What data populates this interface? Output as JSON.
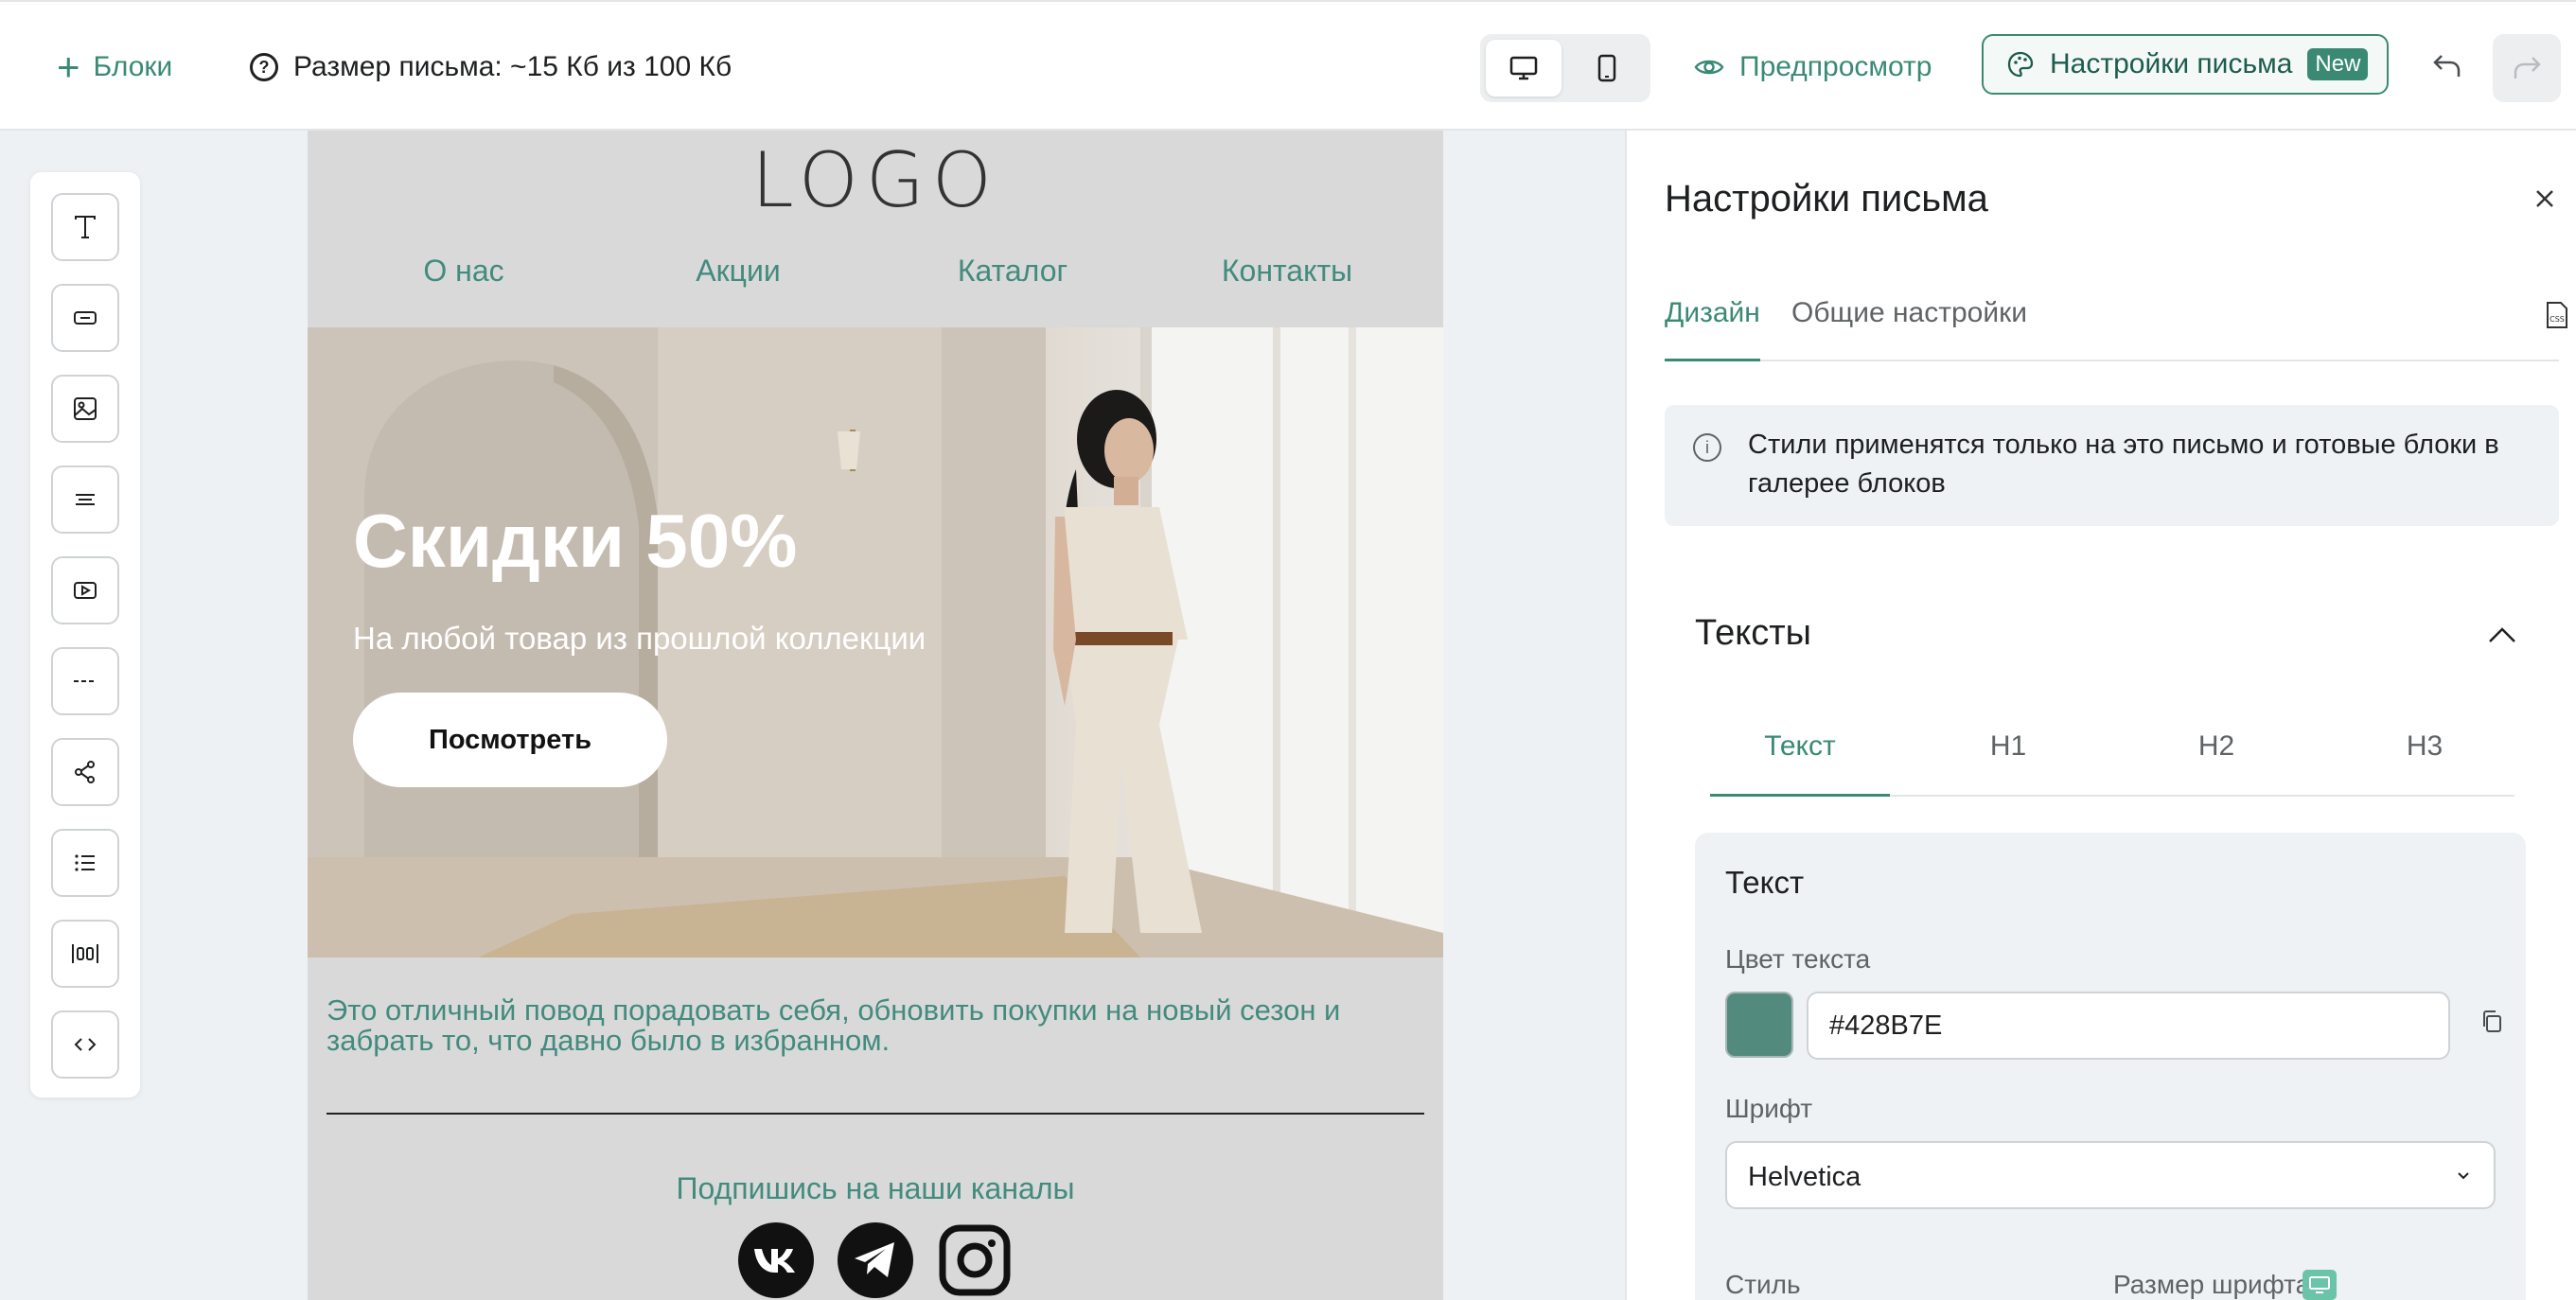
{
  "topbar": {
    "blocks_label": "Блоки",
    "size_label": "Размер письма: ~15 Кб из 100 Кб",
    "preview_label": "Предпросмотр",
    "settings_label": "Настройки письма",
    "new_badge": "New"
  },
  "email": {
    "logo": "LOGO",
    "nav": [
      "О нас",
      "Акции",
      "Каталог",
      "Контакты"
    ],
    "hero_title": "Скидки 50%",
    "hero_subtitle": "На любой товар из прошлой коллекции",
    "hero_button": "Посмотреть",
    "promo_text": "Это отличный повод порадовать себя, обновить покупки на новый сезон и забрать то, что давно было в избранном.",
    "subscribe_text": "Подпишись на наши каналы",
    "social_icons": [
      "vk-icon",
      "telegram-icon",
      "instagram-icon"
    ]
  },
  "panel": {
    "title": "Настройки письма",
    "tabs": [
      "Дизайн",
      "Общие настройки"
    ],
    "active_tab": "Дизайн",
    "info_text": "Стили применятся только на это письмо и готовые блоки в галерее блоков",
    "section_title": "Тексты",
    "sub_tabs": [
      "Текст",
      "H1",
      "H2",
      "H3"
    ],
    "active_sub_tab": "Текст",
    "card": {
      "title": "Текст",
      "color_label": "Цвет текста",
      "color_value": "#428B7E",
      "font_label": "Шрифт",
      "font_value": "Helvetica",
      "style_label": "Стиль",
      "font_size_label": "Размер шрифта"
    }
  },
  "toolbar_icons": [
    "text-tool-icon",
    "button-tool-icon",
    "image-tool-icon",
    "text-block-tool-icon",
    "video-tool-icon",
    "divider-tool-icon",
    "share-tool-icon",
    "list-tool-icon",
    "columns-tool-icon",
    "code-tool-icon"
  ],
  "colors": {
    "accent": "#3a8a73",
    "email_text": "#428b7e",
    "swatch": "#538a7e"
  }
}
